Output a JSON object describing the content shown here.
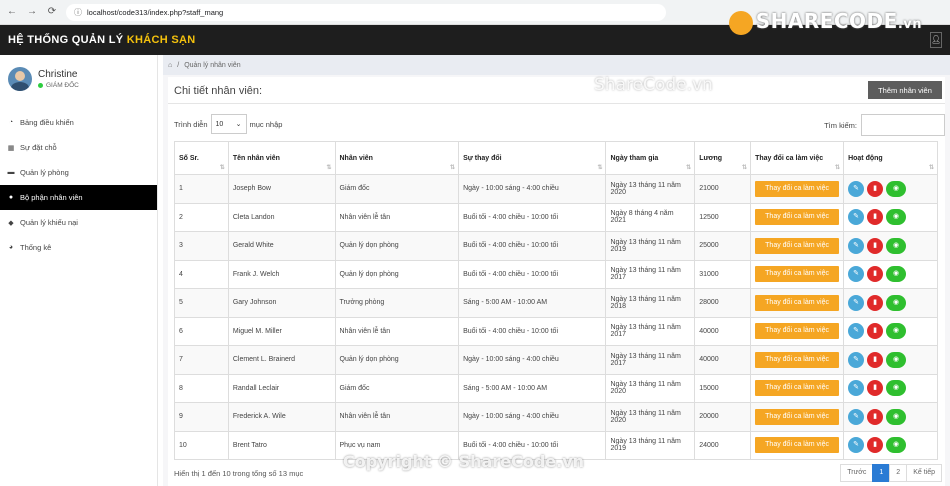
{
  "browser": {
    "url": "localhost/code313/index.php?staff_mang"
  },
  "watermarks": {
    "brand": "SHARECODE",
    "brand_tld": ".vn",
    "center": "ShareCode.vn",
    "bottom": "Copyright © ShareCode.vn"
  },
  "header": {
    "title_prefix": "HỆ THỐNG QUẢN LÝ ",
    "title_highlight": "KHÁCH SẠN"
  },
  "profile": {
    "name": "Christine",
    "role": "GIÁM ĐỐC"
  },
  "sidebar": {
    "items": [
      {
        "label": "Bảng điều khiển",
        "icon": "dashboard-icon"
      },
      {
        "label": "Sự đặt chỗ",
        "icon": "calendar-icon"
      },
      {
        "label": "Quản lý phòng",
        "icon": "bed-icon"
      },
      {
        "label": "Bộ phận nhân viên",
        "icon": "users-icon"
      },
      {
        "label": "Quản lý khiếu nại",
        "icon": "comments-icon"
      },
      {
        "label": "Thống kê",
        "icon": "pie-chart-icon"
      }
    ]
  },
  "breadcrumb": {
    "current": "Quản lý nhân viên"
  },
  "panel": {
    "title": "Chi tiết nhân viên:",
    "add_label": "Thêm nhân viên",
    "length_prefix": "Trình diễn",
    "length_value": "10",
    "length_suffix": "mục nhập",
    "search_label": "Tìm kiếm:"
  },
  "table": {
    "headers": [
      "Số Sr.",
      "Tên nhân viên",
      "Nhân viên",
      "Sự thay đổi",
      "Ngày tham gia",
      "Lương",
      "Thay đổi ca làm việc",
      "Hoạt động"
    ],
    "shift_button_label": "Thay đổi ca làm việc",
    "rows": [
      {
        "no": "1",
        "name": "Joseph Bow",
        "role": "Giám đốc",
        "shift": "Ngày - 10:00 sáng - 4:00 chiều",
        "joined": "Ngày 13 tháng 11 năm 2020",
        "salary": "21000"
      },
      {
        "no": "2",
        "name": "Cleta Landon",
        "role": "Nhân viên lễ tân",
        "shift": "Buổi tối - 4:00 chiều - 10:00 tối",
        "joined": "Ngày 8 tháng 4 năm 2021",
        "salary": "12500"
      },
      {
        "no": "3",
        "name": "Gerald White",
        "role": "Quản lý dọn phòng",
        "shift": "Buổi tối - 4:00 chiều - 10:00 tối",
        "joined": "Ngày 13 tháng 11 năm 2019",
        "salary": "25000"
      },
      {
        "no": "4",
        "name": "Frank J. Welch",
        "role": "Quản lý dọn phòng",
        "shift": "Buổi tối - 4:00 chiều - 10:00 tối",
        "joined": "Ngày 13 tháng 11 năm 2017",
        "salary": "31000"
      },
      {
        "no": "5",
        "name": "Gary Johnson",
        "role": "Trưởng phòng",
        "shift": "Sáng - 5:00 AM - 10:00 AM",
        "joined": "Ngày 13 tháng 11 năm 2018",
        "salary": "28000"
      },
      {
        "no": "6",
        "name": "Miguel M. Miller",
        "role": "Nhân viên lễ tân",
        "shift": "Buổi tối - 4:00 chiều - 10:00 tối",
        "joined": "Ngày 13 tháng 11 năm 2017",
        "salary": "40000"
      },
      {
        "no": "7",
        "name": "Clement L. Brainerd",
        "role": "Quản lý dọn phòng",
        "shift": "Ngày - 10:00 sáng - 4:00 chiều",
        "joined": "Ngày 13 tháng 11 năm 2017",
        "salary": "40000"
      },
      {
        "no": "8",
        "name": "Randall Leclair",
        "role": "Giám đốc",
        "shift": "Sáng - 5:00 AM - 10:00 AM",
        "joined": "Ngày 13 tháng 11 năm 2020",
        "salary": "15000"
      },
      {
        "no": "9",
        "name": "Frederick A. Wile",
        "role": "Nhân viên lễ tân",
        "shift": "Ngày - 10:00 sáng - 4:00 chiều",
        "joined": "Ngày 13 tháng 11 năm 2020",
        "salary": "20000"
      },
      {
        "no": "10",
        "name": "Brent Tatro",
        "role": "Phục vụ nam",
        "shift": "Buổi tối - 4:00 chiều - 10:00 tối",
        "joined": "Ngày 13 tháng 11 năm 2019",
        "salary": "24000"
      }
    ]
  },
  "footer": {
    "info": "Hiển thị 1 đến 10 trong tổng số 13 mục",
    "prev": "Trước",
    "pages": [
      "1",
      "2"
    ],
    "next": "Kế tiếp"
  },
  "colors": {
    "accent": "#f5c20d",
    "shift_button": "#f5a623",
    "edit": "#4aa8d8",
    "delete": "#e02a2a",
    "view": "#2fbf2f",
    "pager_active": "#2a7bd4"
  }
}
